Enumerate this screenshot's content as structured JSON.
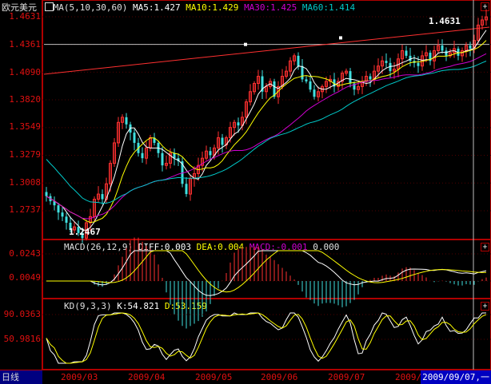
{
  "period_label": "日线",
  "cursor_date": "2009/09/07,一",
  "main": {
    "title": "欧元美元",
    "indicator_name": "MA(5,10,30,60)",
    "ma5": "MA5:1.427",
    "ma10": "MA10:1.429",
    "ma30": "MA30:1.425",
    "ma60": "MA60:1.414",
    "y_ticks": [
      "1.4631",
      "1.4361",
      "1.4090",
      "1.3820",
      "1.3549",
      "1.3279",
      "1.3008",
      "1.2737"
    ],
    "high_label": "1.4631",
    "low_label": "1.2467",
    "plus": "+"
  },
  "macd": {
    "name": "MACD(26,12,9)",
    "diff": "DIFF:0.003",
    "dea": "DEA:0.004",
    "macd": "MACD:-0.001",
    "extra": "0.000",
    "y_ticks": [
      "0.0243",
      "0.0049"
    ],
    "plus": "+"
  },
  "kd": {
    "name": "KD(9,3,3)",
    "k": "K:54.821",
    "d": "D:53.159",
    "y_ticks": [
      "90.0363",
      "50.9816"
    ],
    "plus": "+"
  },
  "x_ticks": [
    "2009/03",
    "2009/04",
    "2009/05",
    "2009/06",
    "2009/07",
    "2009/"
  ],
  "colors": {
    "up": "#ff3030",
    "down": "#40e0e0",
    "ma5": "#ffffff",
    "ma10": "#ffff00",
    "ma30": "#d000d0",
    "ma60": "#00c8c8",
    "frame": "#b00000",
    "axis_text": "#e01010"
  },
  "chart_data": [
    {
      "type": "candlestick",
      "title": "欧元美元",
      "y_ticks": [
        1.4631,
        1.4361,
        1.409,
        1.382,
        1.3549,
        1.3279,
        1.3008,
        1.2737
      ],
      "ylim": [
        1.245,
        1.47
      ],
      "high": 1.4631,
      "low": 1.2467,
      "series": [
        {
          "name": "MA5",
          "values": [
            1.427
          ]
        },
        {
          "name": "MA10",
          "values": [
            1.429
          ]
        },
        {
          "name": "MA30",
          "values": [
            1.425
          ]
        },
        {
          "name": "MA60",
          "values": [
            1.414
          ]
        }
      ],
      "close_path": [
        1.288,
        1.283,
        1.279,
        1.272,
        1.268,
        1.262,
        1.255,
        1.258,
        1.252,
        1.247,
        1.262,
        1.268,
        1.285,
        1.29,
        1.285,
        1.3,
        1.32,
        1.34,
        1.36,
        1.365,
        1.358,
        1.35,
        1.34,
        1.33,
        1.325,
        1.335,
        1.345,
        1.34,
        1.33,
        1.318,
        1.32,
        1.33,
        1.325,
        1.322,
        1.3,
        1.29,
        1.305,
        1.31,
        1.318,
        1.325,
        1.332,
        1.328,
        1.335,
        1.345,
        1.338,
        1.345,
        1.355,
        1.36,
        1.357,
        1.365,
        1.38,
        1.39,
        1.398,
        1.405,
        1.39,
        1.395,
        1.4,
        1.385,
        1.395,
        1.405,
        1.41,
        1.42,
        1.425,
        1.415,
        1.402,
        1.4,
        1.392,
        1.385,
        1.39,
        1.395,
        1.4,
        1.402,
        1.395,
        1.4,
        1.408,
        1.41,
        1.398,
        1.392,
        1.395,
        1.4,
        1.405,
        1.402,
        1.41,
        1.415,
        1.42,
        1.418,
        1.41,
        1.412,
        1.422,
        1.43,
        1.425,
        1.42,
        1.418,
        1.415,
        1.425,
        1.428,
        1.42,
        1.43,
        1.435,
        1.43,
        1.425,
        1.428,
        1.432,
        1.425,
        1.43,
        1.435,
        1.432,
        1.44,
        1.455,
        1.46,
        1.463
      ]
    },
    {
      "type": "line",
      "title": "MACD(26,12,9)",
      "y_ticks": [
        0.0243,
        0.0049
      ],
      "series": [
        {
          "name": "DIFF",
          "values": [
            0.003
          ]
        },
        {
          "name": "DEA",
          "values": [
            0.004
          ]
        },
        {
          "name": "MACD",
          "values": [
            -0.001
          ]
        }
      ]
    },
    {
      "type": "line",
      "title": "KD(9,3,3)",
      "y_ticks": [
        90.0363,
        50.9816
      ],
      "series": [
        {
          "name": "K",
          "values": [
            54.821
          ]
        },
        {
          "name": "D",
          "values": [
            53.159
          ]
        }
      ]
    }
  ]
}
